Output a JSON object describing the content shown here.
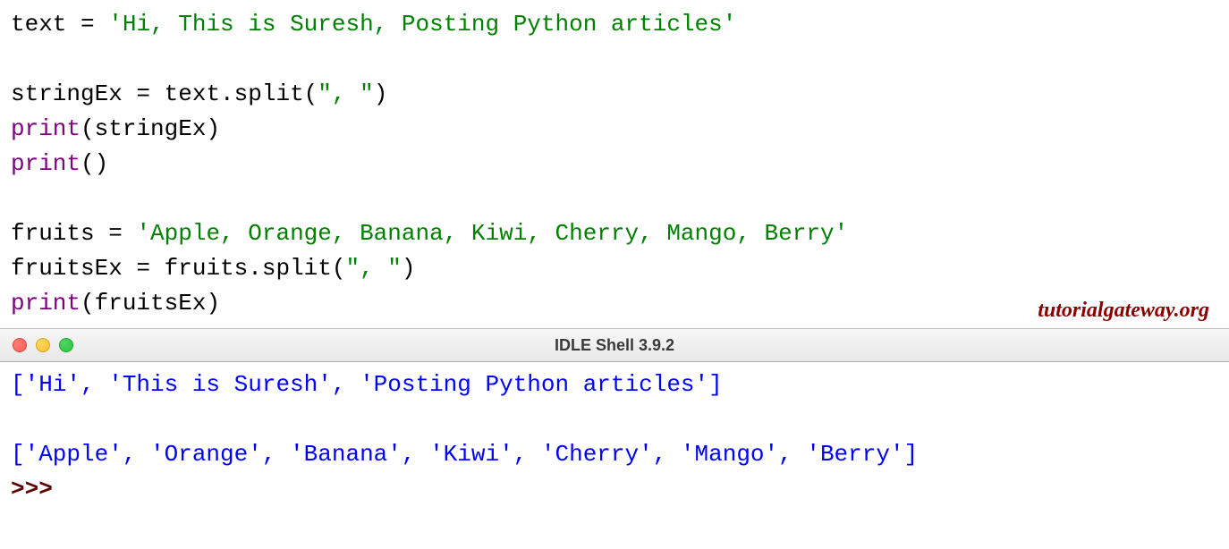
{
  "editor": {
    "lines": [
      {
        "type": "assign",
        "var": "text",
        "eq": " = ",
        "str": "'Hi, This is Suresh, Posting Python articles'"
      },
      {
        "type": "blank"
      },
      {
        "type": "assign",
        "var": "stringEx",
        "eq": " = ",
        "expr": "text.split(",
        "arg": "\", \"",
        "close": ")"
      },
      {
        "type": "print",
        "fn": "print",
        "open": "(",
        "arg": "stringEx",
        "close": ")"
      },
      {
        "type": "print",
        "fn": "print",
        "open": "(",
        "arg": "",
        "close": ")"
      },
      {
        "type": "blank"
      },
      {
        "type": "assign",
        "var": "fruits",
        "eq": " = ",
        "str": "'Apple, Orange, Banana, Kiwi, Cherry, Mango, Berry'"
      },
      {
        "type": "assign",
        "var": "fruitsEx",
        "eq": " = ",
        "expr": "fruits.split(",
        "arg": "\", \"",
        "close": ")"
      },
      {
        "type": "print",
        "fn": "print",
        "open": "(",
        "arg": "fruitsEx",
        "close": ")"
      }
    ]
  },
  "watermark": "tutorialgateway.org",
  "titlebar": {
    "title": "IDLE Shell 3.9.2"
  },
  "shell": {
    "output1": "['Hi', 'This is Suresh', 'Posting Python articles']",
    "blank": "",
    "output2": "['Apple', 'Orange', 'Banana', 'Kiwi', 'Cherry', 'Mango', 'Berry']",
    "prompt": ">>> "
  }
}
